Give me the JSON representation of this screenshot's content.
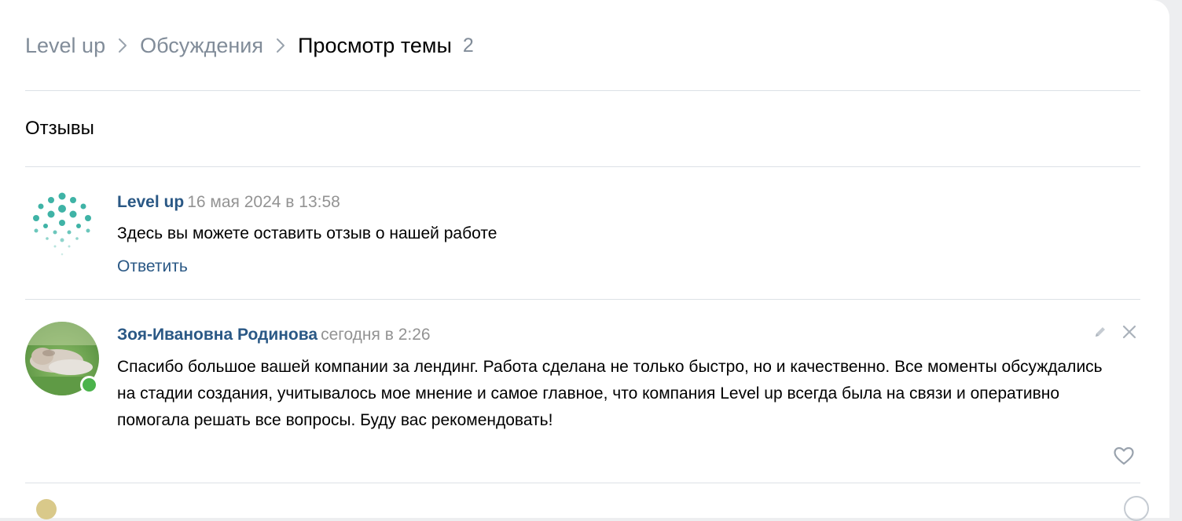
{
  "breadcrumb": {
    "items": [
      "Level up",
      "Обсуждения"
    ],
    "current": "Просмотр темы",
    "count": "2"
  },
  "topic": {
    "title": "Отзывы"
  },
  "posts": [
    {
      "author": "Level up",
      "date": "16 мая 2024 в 13:58",
      "text": "Здесь вы можете оставить отзыв о нашей работе",
      "reply_label": "Ответить"
    },
    {
      "author": "Зоя-Ивановна Родинова",
      "date": "сегодня в 2:26",
      "text": "Спасибо большое вашей компании за лендинг. Работа сделана не только быстро, но и качественно. Все моменты обсуждались на стадии создания, учитывалось мое мнение и самое главное, что компания Level up всегда была на связи и оперативно помогала решать все вопросы. Буду вас рекомендовать!",
      "online": true
    }
  ],
  "icons": {
    "chevron": "chevron-right-icon",
    "edit": "pencil-icon",
    "delete": "close-icon",
    "like": "heart-icon"
  },
  "colors": {
    "link": "#2a5885",
    "secondary": "#818c99",
    "online": "#4bb34b",
    "logo_teal": "#3fb3a6"
  }
}
